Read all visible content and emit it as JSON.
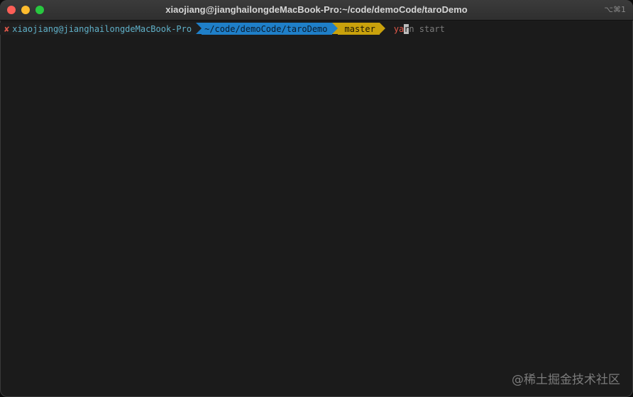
{
  "window": {
    "title": "xiaojiang@jianghailongdeMacBook-Pro:~/code/demoCode/taroDemo",
    "shortcut": "⌥⌘1"
  },
  "colors": {
    "close": "#fe5f57",
    "minimize": "#febc2e",
    "zoom": "#28c840",
    "status_fail": "#e0584a",
    "user_text": "#5fb0c8",
    "dir_bg": "#1f7fc8",
    "dir_text": "#0b1b2c",
    "git_bg": "#c9a10c",
    "git_text": "#1b1606"
  },
  "prompt": {
    "status_icon": "✘",
    "user": "xiaojiang@jianghailongdeMacBook-Pro",
    "directory": "~/code/demoCode/taroDemo",
    "branch_icon": "",
    "branch": "master"
  },
  "command": {
    "typed": "ya",
    "cursor_char": "r",
    "suggestion": "n start"
  },
  "watermark": "@稀土掘金技术社区"
}
